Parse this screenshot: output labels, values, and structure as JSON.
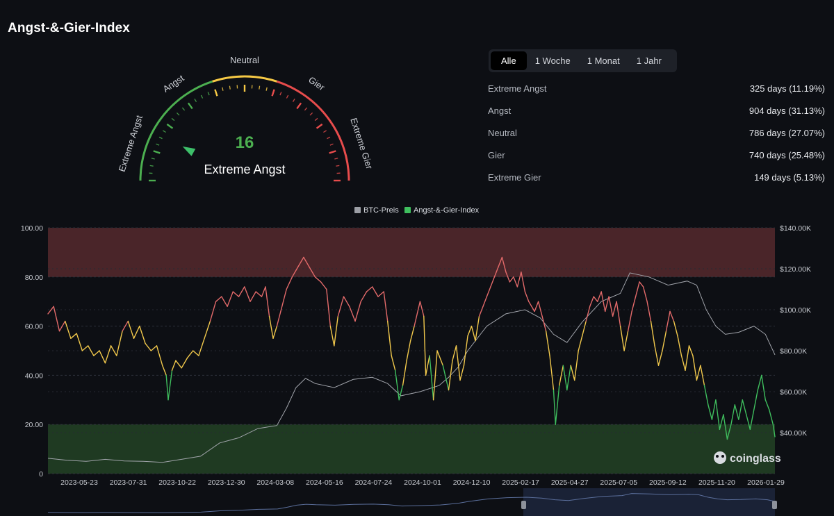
{
  "page": {
    "title": "Angst-&-Gier-Index"
  },
  "gauge": {
    "value": 16,
    "value_label": "Extreme Angst",
    "zone_labels": [
      "Extreme Angst",
      "Angst",
      "Neutral",
      "Gier",
      "Extreme Gier"
    ],
    "colors": {
      "fear": "#4caf50",
      "neutral": "#f6c945",
      "greed": "#e74c4c",
      "needle": "#3dbf6a"
    }
  },
  "tabs": [
    {
      "label": "Alle",
      "active": true
    },
    {
      "label": "1 Woche",
      "active": false
    },
    {
      "label": "1 Monat",
      "active": false
    },
    {
      "label": "1 Jahr",
      "active": false
    }
  ],
  "stats": [
    {
      "label": "Extreme Angst",
      "value": "325 days (11.19%)"
    },
    {
      "label": "Angst",
      "value": "904 days (31.13%)"
    },
    {
      "label": "Neutral",
      "value": "786 days (27.07%)"
    },
    {
      "label": "Gier",
      "value": "740 days (25.48%)"
    },
    {
      "label": "Extreme Gier",
      "value": "149 days (5.13%)"
    }
  ],
  "chart_data": {
    "type": "line",
    "legend": [
      {
        "name": "BTC-Preis",
        "color": "#9b9ea5"
      },
      {
        "name": "Angst-&-Gier-Index",
        "color": "#3fbf5e"
      }
    ],
    "legend_position": "top-center",
    "x_ticks": [
      "2023-05-23",
      "2023-07-31",
      "2023-10-22",
      "2023-12-30",
      "2024-03-08",
      "2024-05-16",
      "2024-07-24",
      "2024-10-01",
      "2024-12-10",
      "2025-02-17",
      "2025-04-27",
      "2025-07-05",
      "2025-09-12",
      "2025-11-20",
      "2026-01-29"
    ],
    "y_left_ticks": [
      "0",
      "20.00",
      "40.00",
      "60.00",
      "80.00",
      "100.00"
    ],
    "y_left_lim": [
      0,
      100
    ],
    "y_right_ticks": [
      "$40.00K",
      "$60.00K",
      "$80.00K",
      "$100.00K",
      "$120.00K",
      "$140.00K"
    ],
    "y_right_lim": [
      20000,
      140000
    ],
    "bands": [
      {
        "from": 80,
        "to": 100,
        "color": "#4a2529"
      },
      {
        "from": 0,
        "to": 20,
        "color": "#1f3a22"
      }
    ],
    "grid": true,
    "series": [
      {
        "name": "Angst-&-Gier-Index",
        "axis": "left",
        "points": [
          [
            0,
            65
          ],
          [
            3,
            68
          ],
          [
            6,
            58
          ],
          [
            9,
            62
          ],
          [
            12,
            55
          ],
          [
            15,
            57
          ],
          [
            18,
            50
          ],
          [
            21,
            52
          ],
          [
            24,
            48
          ],
          [
            27,
            50
          ],
          [
            30,
            45
          ],
          [
            33,
            52
          ],
          [
            36,
            48
          ],
          [
            39,
            58
          ],
          [
            42,
            62
          ],
          [
            45,
            55
          ],
          [
            48,
            60
          ],
          [
            51,
            53
          ],
          [
            54,
            50
          ],
          [
            57,
            52
          ],
          [
            60,
            44
          ],
          [
            62,
            40
          ],
          [
            63,
            30
          ],
          [
            65,
            42
          ],
          [
            67,
            46
          ],
          [
            70,
            43
          ],
          [
            73,
            47
          ],
          [
            76,
            50
          ],
          [
            79,
            48
          ],
          [
            82,
            55
          ],
          [
            85,
            62
          ],
          [
            88,
            70
          ],
          [
            91,
            72
          ],
          [
            94,
            68
          ],
          [
            97,
            74
          ],
          [
            100,
            72
          ],
          [
            103,
            76
          ],
          [
            106,
            70
          ],
          [
            109,
            74
          ],
          [
            112,
            72
          ],
          [
            114,
            76
          ],
          [
            116,
            64
          ],
          [
            118,
            55
          ],
          [
            120,
            60
          ],
          [
            122,
            66
          ],
          [
            125,
            75
          ],
          [
            128,
            80
          ],
          [
            131,
            84
          ],
          [
            134,
            88
          ],
          [
            137,
            84
          ],
          [
            140,
            80
          ],
          [
            143,
            78
          ],
          [
            146,
            75
          ],
          [
            148,
            60
          ],
          [
            150,
            52
          ],
          [
            152,
            64
          ],
          [
            155,
            72
          ],
          [
            158,
            68
          ],
          [
            161,
            62
          ],
          [
            164,
            70
          ],
          [
            167,
            74
          ],
          [
            170,
            76
          ],
          [
            173,
            72
          ],
          [
            176,
            74
          ],
          [
            178,
            62
          ],
          [
            180,
            48
          ],
          [
            182,
            42
          ],
          [
            184,
            30
          ],
          [
            186,
            36
          ],
          [
            188,
            46
          ],
          [
            190,
            54
          ],
          [
            192,
            60
          ],
          [
            195,
            70
          ],
          [
            197,
            64
          ],
          [
            198,
            40
          ],
          [
            200,
            48
          ],
          [
            202,
            30
          ],
          [
            204,
            50
          ],
          [
            207,
            44
          ],
          [
            210,
            34
          ],
          [
            212,
            46
          ],
          [
            214,
            52
          ],
          [
            216,
            38
          ],
          [
            218,
            44
          ],
          [
            220,
            56
          ],
          [
            222,
            60
          ],
          [
            224,
            54
          ],
          [
            226,
            64
          ],
          [
            228,
            68
          ],
          [
            230,
            72
          ],
          [
            232,
            76
          ],
          [
            234,
            80
          ],
          [
            236,
            84
          ],
          [
            238,
            88
          ],
          [
            240,
            82
          ],
          [
            242,
            78
          ],
          [
            244,
            80
          ],
          [
            246,
            76
          ],
          [
            248,
            82
          ],
          [
            250,
            74
          ],
          [
            252,
            70
          ],
          [
            255,
            66
          ],
          [
            257,
            70
          ],
          [
            259,
            64
          ],
          [
            261,
            58
          ],
          [
            263,
            48
          ],
          [
            265,
            34
          ],
          [
            266,
            20
          ],
          [
            268,
            36
          ],
          [
            270,
            44
          ],
          [
            272,
            34
          ],
          [
            274,
            44
          ],
          [
            276,
            38
          ],
          [
            278,
            50
          ],
          [
            280,
            56
          ],
          [
            282,
            62
          ],
          [
            284,
            68
          ],
          [
            286,
            72
          ],
          [
            288,
            70
          ],
          [
            290,
            74
          ],
          [
            292,
            66
          ],
          [
            294,
            72
          ],
          [
            296,
            64
          ],
          [
            298,
            70
          ],
          [
            300,
            60
          ],
          [
            302,
            50
          ],
          [
            304,
            58
          ],
          [
            306,
            66
          ],
          [
            308,
            72
          ],
          [
            310,
            78
          ],
          [
            312,
            76
          ],
          [
            314,
            70
          ],
          [
            316,
            62
          ],
          [
            318,
            52
          ],
          [
            320,
            44
          ],
          [
            322,
            50
          ],
          [
            324,
            58
          ],
          [
            326,
            66
          ],
          [
            328,
            62
          ],
          [
            330,
            56
          ],
          [
            332,
            48
          ],
          [
            334,
            42
          ],
          [
            336,
            52
          ],
          [
            338,
            48
          ],
          [
            340,
            38
          ],
          [
            342,
            44
          ],
          [
            344,
            36
          ],
          [
            346,
            28
          ],
          [
            348,
            22
          ],
          [
            350,
            30
          ],
          [
            352,
            18
          ],
          [
            354,
            24
          ],
          [
            356,
            14
          ],
          [
            358,
            20
          ],
          [
            360,
            28
          ],
          [
            362,
            22
          ],
          [
            364,
            30
          ],
          [
            366,
            24
          ],
          [
            368,
            18
          ],
          [
            370,
            26
          ],
          [
            372,
            34
          ],
          [
            374,
            40
          ],
          [
            376,
            30
          ],
          [
            378,
            26
          ],
          [
            380,
            20
          ],
          [
            381,
            15
          ]
        ]
      },
      {
        "name": "BTC-Preis",
        "axis": "right",
        "points": [
          [
            0,
            27500
          ],
          [
            10,
            26500
          ],
          [
            20,
            26000
          ],
          [
            30,
            27000
          ],
          [
            40,
            26200
          ],
          [
            50,
            26000
          ],
          [
            60,
            25500
          ],
          [
            70,
            27000
          ],
          [
            80,
            28500
          ],
          [
            90,
            35000
          ],
          [
            100,
            37500
          ],
          [
            110,
            42000
          ],
          [
            120,
            43500
          ],
          [
            125,
            52000
          ],
          [
            130,
            62000
          ],
          [
            135,
            66500
          ],
          [
            140,
            64000
          ],
          [
            150,
            62000
          ],
          [
            160,
            66000
          ],
          [
            170,
            67000
          ],
          [
            178,
            64000
          ],
          [
            185,
            58000
          ],
          [
            195,
            60000
          ],
          [
            205,
            63000
          ],
          [
            210,
            67000
          ],
          [
            215,
            72000
          ],
          [
            220,
            80000
          ],
          [
            230,
            92000
          ],
          [
            240,
            98000
          ],
          [
            250,
            100000
          ],
          [
            258,
            96000
          ],
          [
            265,
            88000
          ],
          [
            272,
            84000
          ],
          [
            280,
            94000
          ],
          [
            290,
            104000
          ],
          [
            300,
            108000
          ],
          [
            305,
            118000
          ],
          [
            315,
            116000
          ],
          [
            325,
            112000
          ],
          [
            335,
            114000
          ],
          [
            340,
            112000
          ],
          [
            345,
            100000
          ],
          [
            350,
            92000
          ],
          [
            355,
            88000
          ],
          [
            362,
            89000
          ],
          [
            370,
            92000
          ],
          [
            376,
            88000
          ],
          [
            381,
            78000
          ]
        ]
      }
    ]
  },
  "watermark": {
    "text": "coinglass"
  }
}
